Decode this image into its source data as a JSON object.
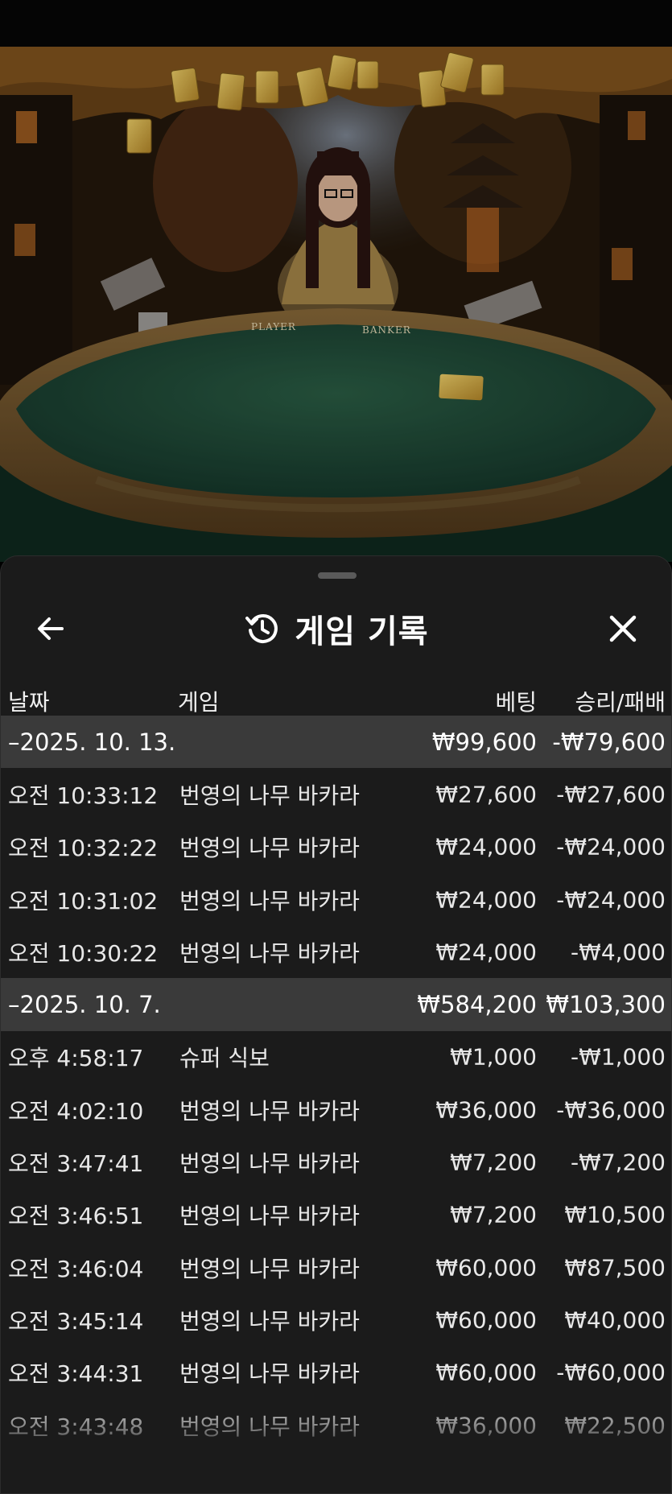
{
  "header": {
    "title": "게임 기록",
    "back_icon": "arrow-left-icon",
    "history_icon": "history-clock-icon",
    "close_icon": "close-icon"
  },
  "table_overlay_text": {
    "player": "PLAYER",
    "banker": "BANKER"
  },
  "columns": {
    "date": "날짜",
    "game": "게임",
    "bet": "베팅",
    "result": "승리/패배"
  },
  "groups": [
    {
      "date": "–2025. 10. 13.",
      "bet_total": "₩99,600",
      "result_total": "-₩79,600",
      "rows": [
        {
          "time": "오전 10:33:12",
          "game": "번영의 나무 바카라",
          "bet": "₩27,600",
          "result": "-₩27,600"
        },
        {
          "time": "오전 10:32:22",
          "game": "번영의 나무 바카라",
          "bet": "₩24,000",
          "result": "-₩24,000"
        },
        {
          "time": "오전 10:31:02",
          "game": "번영의 나무 바카라",
          "bet": "₩24,000",
          "result": "-₩24,000"
        },
        {
          "time": "오전 10:30:22",
          "game": "번영의 나무 바카라",
          "bet": "₩24,000",
          "result": "-₩4,000"
        }
      ]
    },
    {
      "date": "–2025. 10. 7.",
      "bet_total": "₩584,200",
      "result_total": "₩103,300",
      "rows": [
        {
          "time": "오후 4:58:17",
          "game": "슈퍼 식보",
          "bet": "₩1,000",
          "result": "-₩1,000"
        },
        {
          "time": "오전 4:02:10",
          "game": "번영의 나무 바카라",
          "bet": "₩36,000",
          "result": "-₩36,000"
        },
        {
          "time": "오전 3:47:41",
          "game": "번영의 나무 바카라",
          "bet": "₩7,200",
          "result": "-₩7,200"
        },
        {
          "time": "오전 3:46:51",
          "game": "번영의 나무 바카라",
          "bet": "₩7,200",
          "result": "₩10,500"
        },
        {
          "time": "오전 3:46:04",
          "game": "번영의 나무 바카라",
          "bet": "₩60,000",
          "result": "₩87,500"
        },
        {
          "time": "오전 3:45:14",
          "game": "번영의 나무 바카라",
          "bet": "₩60,000",
          "result": "₩40,000"
        },
        {
          "time": "오전 3:44:31",
          "game": "번영의 나무 바카라",
          "bet": "₩60,000",
          "result": "-₩60,000"
        },
        {
          "time": "오전 3:43:48",
          "game": "번영의 나무 바카라",
          "bet": "₩36,000",
          "result": "₩22,500"
        }
      ]
    }
  ],
  "colors": {
    "sheet_bg": "#1b1b1b",
    "group_row_bg": "#3a3a3a",
    "text": "#e8e8e8",
    "table_felt": "#1f4a35",
    "gold": "#d9b24a"
  }
}
